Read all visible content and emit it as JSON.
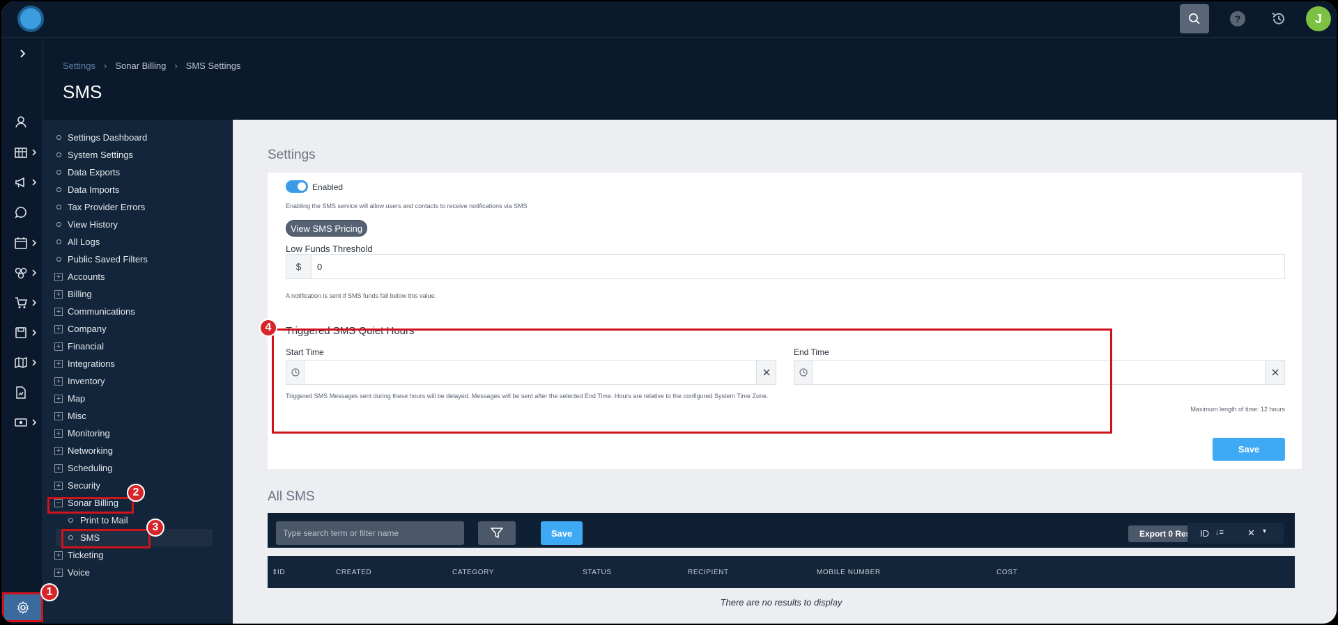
{
  "topbar": {
    "avatar_initial": "J"
  },
  "header": {
    "breadcrumbs": [
      "Settings",
      "Sonar Billing",
      "SMS Settings"
    ],
    "title": "SMS"
  },
  "settings_nav": {
    "items": [
      {
        "label": "Settings Dashboard",
        "kind": "leaf"
      },
      {
        "label": "System Settings",
        "kind": "leaf"
      },
      {
        "label": "Data Exports",
        "kind": "leaf"
      },
      {
        "label": "Data Imports",
        "kind": "leaf"
      },
      {
        "label": "Tax Provider Errors",
        "kind": "leaf"
      },
      {
        "label": "View History",
        "kind": "leaf"
      },
      {
        "label": "All Logs",
        "kind": "leaf"
      },
      {
        "label": "Public Saved Filters",
        "kind": "leaf"
      },
      {
        "label": "Accounts",
        "kind": "group"
      },
      {
        "label": "Billing",
        "kind": "group"
      },
      {
        "label": "Communications",
        "kind": "group"
      },
      {
        "label": "Company",
        "kind": "group"
      },
      {
        "label": "Financial",
        "kind": "group"
      },
      {
        "label": "Integrations",
        "kind": "group"
      },
      {
        "label": "Inventory",
        "kind": "group"
      },
      {
        "label": "Map",
        "kind": "group"
      },
      {
        "label": "Misc",
        "kind": "group"
      },
      {
        "label": "Monitoring",
        "kind": "group"
      },
      {
        "label": "Networking",
        "kind": "group"
      },
      {
        "label": "Scheduling",
        "kind": "group"
      },
      {
        "label": "Security",
        "kind": "group"
      },
      {
        "label": "Sonar Billing",
        "kind": "group-open"
      },
      {
        "label": "Print to Mail",
        "kind": "sub"
      },
      {
        "label": "SMS",
        "kind": "sub-active"
      },
      {
        "label": "Ticketing",
        "kind": "group"
      },
      {
        "label": "Voice",
        "kind": "group"
      }
    ]
  },
  "settings_section": {
    "title": "Settings",
    "enabled_label": "Enabled",
    "enabled": true,
    "enabled_help": "Enabling the SMS service will allow users and contacts to receive notifications via SMS",
    "pricing_button": "View SMS Pricing",
    "low_funds_label": "Low Funds Threshold",
    "currency_symbol": "$",
    "low_funds_value": "0",
    "low_funds_help": "A notification is sent if SMS funds fall below this value.",
    "quiet_hours_title": "Triggered SMS Quiet Hours",
    "start_time_label": "Start Time",
    "start_time_value": "",
    "end_time_label": "End Time",
    "end_time_value": "",
    "quiet_hours_help": "Triggered SMS Messages sent during these hours will be delayed. Messages will be sent after the selected End Time. Hours are relative to the configured System Time Zone.",
    "max_length_note": "Maximum length of time: 12 hours",
    "save_label": "Save"
  },
  "all_sms": {
    "title": "All SMS",
    "search_placeholder": "Type search term or filter name",
    "save_label": "Save",
    "export_label": "Export 0 Results",
    "sort_value": "ID",
    "columns": [
      "ID",
      "CREATED",
      "CATEGORY",
      "STATUS",
      "RECIPIENT",
      "MOBILE NUMBER",
      "COST"
    ],
    "empty_text": "There are no results to display"
  },
  "annotations": [
    "1",
    "2",
    "3",
    "4"
  ],
  "colors": {
    "accent": "#3ea9f5",
    "highlight": "#d0121b",
    "nav_bg": "#0a1a2c"
  }
}
